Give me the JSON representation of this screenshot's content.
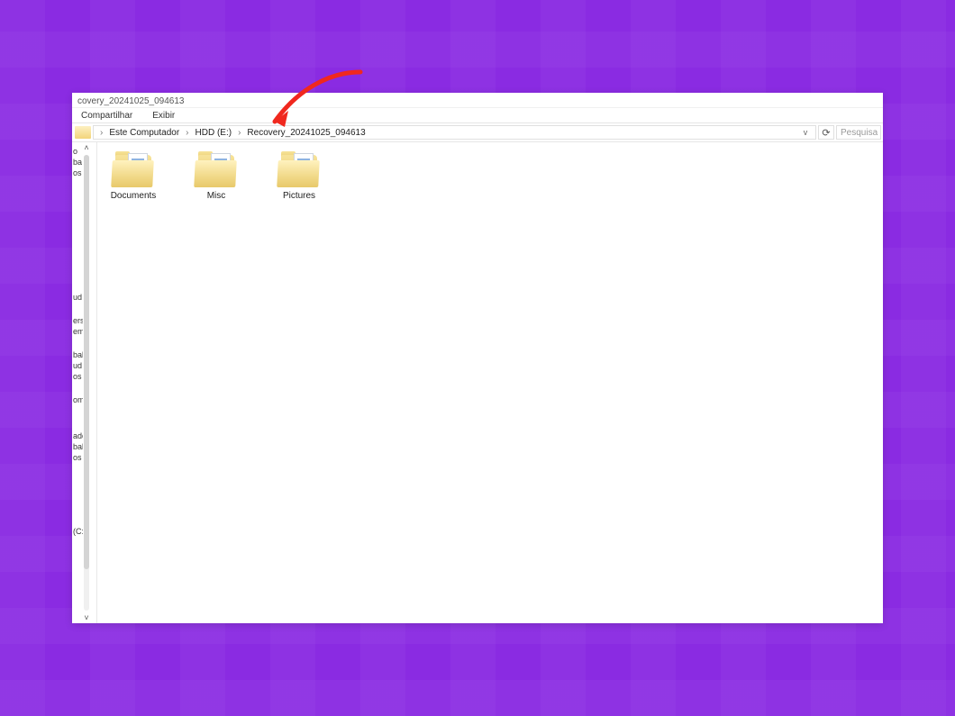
{
  "accent_arrow_color": "#f0281e",
  "window": {
    "title": "covery_20241025_094613"
  },
  "menu": {
    "share": "Compartilhar",
    "view": "Exibir"
  },
  "breadcrumb": {
    "root_icon": "folder-icon",
    "items": [
      "Este Computador",
      "HDD (E:)",
      "Recovery_20241025_094613"
    ],
    "dropdown_glyph": "v",
    "refresh_glyph": "⟳"
  },
  "search": {
    "placeholder": "Pesquisa"
  },
  "sidebar": {
    "items": [
      {
        "label": "o"
      },
      {
        "label": "ba"
      },
      {
        "label": "os"
      },
      {
        "label": ""
      },
      {
        "label": ""
      },
      {
        "label": ""
      },
      {
        "label": ""
      },
      {
        "label": ""
      },
      {
        "label": ""
      },
      {
        "label": ""
      },
      {
        "label": ""
      },
      {
        "label": ""
      },
      {
        "label": "ud"
      },
      {
        "label": ""
      },
      {
        "label": "erson"
      },
      {
        "label": "email"
      },
      {
        "label": ""
      },
      {
        "label": "balho"
      },
      {
        "label": "ud F"
      },
      {
        "label": "os"
      },
      {
        "label": ""
      },
      {
        "label": "ompu"
      },
      {
        "label": ""
      },
      {
        "label": ""
      },
      {
        "label": "ador"
      },
      {
        "label": "balho"
      },
      {
        "label": "os"
      },
      {
        "label": ""
      },
      {
        "label": ""
      },
      {
        "label": ""
      },
      {
        "label": ""
      },
      {
        "label": ""
      },
      {
        "label": "(C:)"
      }
    ]
  },
  "folders": [
    {
      "name": "Documents"
    },
    {
      "name": "Misc"
    },
    {
      "name": "Pictures"
    }
  ]
}
